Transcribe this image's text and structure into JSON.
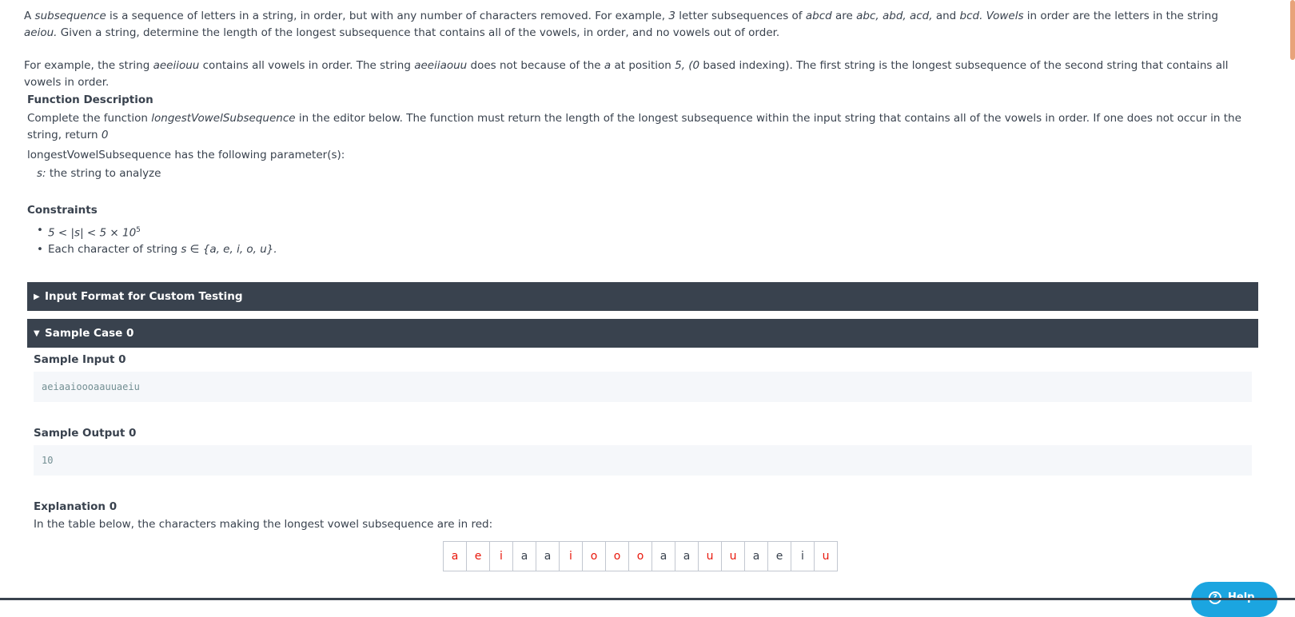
{
  "intro": {
    "p1_a": "A ",
    "p1_term": "subsequence",
    "p1_b": " is a sequence of letters in a string, in order, but with any number of characters removed.  For example, ",
    "p1_num": "3",
    "p1_c": " letter subsequences of ",
    "p1_ex": "abcd",
    "p1_d": " are ",
    "p1_subs": "abc, abd, acd,",
    "p1_e": " and ",
    "p1_last": "bcd.",
    "p1_f": "  ",
    "p1_vowels": "Vowels",
    "p1_g": " in order are the letters in the string ",
    "p1_aeiou": "aeiou.",
    "p1_h": "  Given a string, determine the length of the longest subsequence that contains all of the vowels, in order, and no vowels out of order.",
    "p2_a": "For example, the string ",
    "p2_s1": "aeeiiouu",
    "p2_b": " contains all vowels in order.  The string ",
    "p2_s2": "aeeiiaouu",
    "p2_c": " does not because of the ",
    "p2_a_char": "a",
    "p2_d": " at position ",
    "p2_pos": "5, (0",
    "p2_e": " based indexing).  The first string is the longest subsequence of the second string that contains all vowels in order."
  },
  "function_description": {
    "heading": "Function Description",
    "text_a": "Complete the function ",
    "fn_name": "longestVowelSubsequence",
    "text_b": " in the editor below. The function must return the length of the longest subsequence within the input string that contains all of the vowels in order. If one does not occur in the string, return ",
    "ret_zero": "0",
    "params_line": "longestVowelSubsequence has the following parameter(s):",
    "param_name": "s:",
    "param_desc": " the string to analyze"
  },
  "constraints": {
    "heading": "Constraints",
    "c1": "5 < |s| < 5 × 10",
    "c1_exp": "5",
    "c2_a": "Each character of string ",
    "c2_b": "s ∈ {a, e, i, o, u}."
  },
  "accordions": {
    "input_format": "Input Format for Custom Testing",
    "sample_case": "Sample Case 0"
  },
  "sample": {
    "input_label": "Sample Input 0",
    "input_value": "aeiaaioooaauuaeiu",
    "output_label": "Sample Output 0",
    "output_value": "10",
    "explanation_label": "Explanation 0",
    "explanation_text": "In the table below, the characters making the longest vowel subsequence are in red:"
  },
  "char_table": {
    "chars": [
      "a",
      "e",
      "i",
      "a",
      "a",
      "i",
      "o",
      "o",
      "o",
      "a",
      "a",
      "u",
      "u",
      "a",
      "e",
      "i",
      "u"
    ],
    "red": [
      true,
      true,
      true,
      false,
      false,
      true,
      true,
      true,
      true,
      false,
      false,
      true,
      true,
      false,
      false,
      false,
      true
    ],
    "red_color": "#e8170b"
  },
  "help_button": {
    "label": "Help"
  },
  "colors": {
    "accordion_bg": "#39424e",
    "help_bg": "#1ba5e0"
  }
}
